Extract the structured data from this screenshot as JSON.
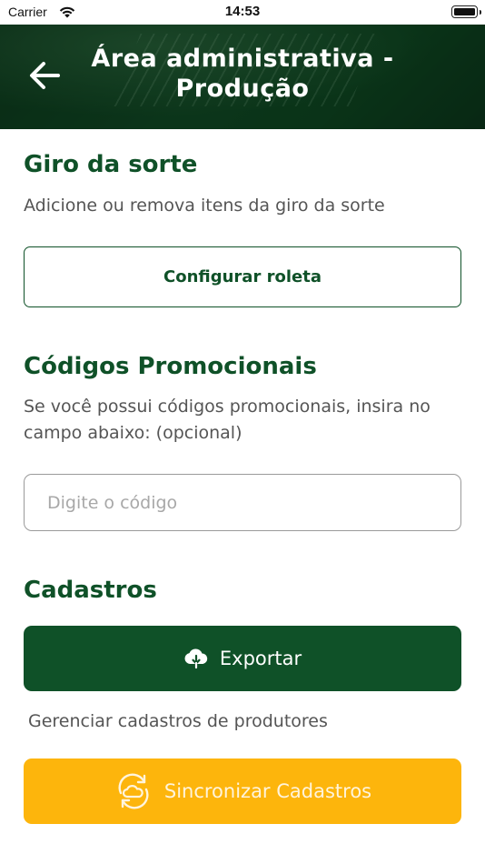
{
  "status_bar": {
    "carrier": "Carrier",
    "time": "14:53"
  },
  "header": {
    "title": "Área administrativa - Produção",
    "back_icon": "arrow-left-icon",
    "background_color": "#123d20"
  },
  "giro": {
    "title": "Giro da sorte",
    "description": "Adicione ou remova itens da giro da sorte",
    "button_label": "Configurar roleta"
  },
  "promo": {
    "title": "Códigos Promocionais",
    "description": "Se você possui códigos promocionais, insira no campo abaixo: (opcional)",
    "input_placeholder": "Digite o código",
    "input_value": ""
  },
  "cadastros": {
    "title": "Cadastros",
    "export_label": "Exportar",
    "export_icon": "cloud-download-icon",
    "manage_text": "Gerenciar cadastros de produtores",
    "sync_label": "Sincronizar Cadastros",
    "sync_icon": "cloud-sync-icon"
  },
  "colors": {
    "primary_green": "#0f5128",
    "accent_yellow": "#fdb50c",
    "text_gray": "#555555"
  }
}
